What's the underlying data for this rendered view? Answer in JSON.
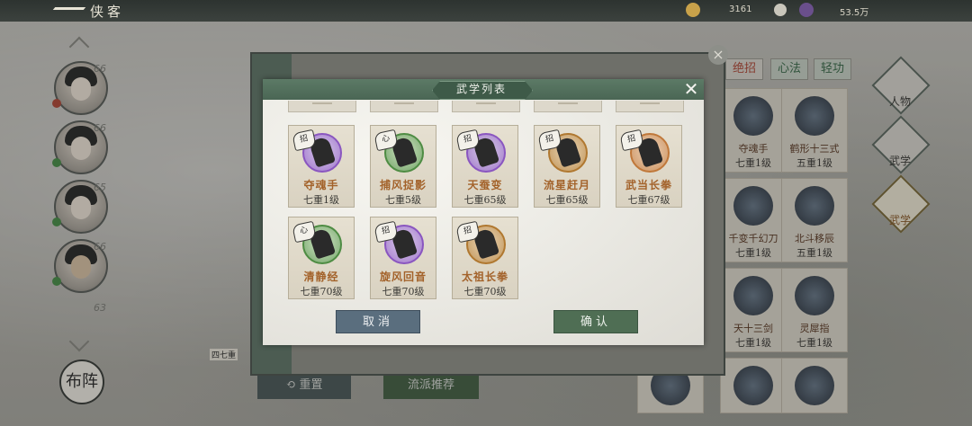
{
  "header": {
    "title": "侠客",
    "resources": [
      {
        "icon": "gold-ingot-icon",
        "value": "3161"
      },
      {
        "icon": "add-icon",
        "value": ""
      },
      {
        "icon": "coin-icon",
        "value": "53.5万"
      }
    ]
  },
  "roster": {
    "levels": [
      "66",
      "66",
      "65",
      "66",
      "63"
    ],
    "formation_label": "布阵"
  },
  "background_buttons": {
    "reset_label": "重置",
    "recommend_label": "流派推荐",
    "partial_level": "四七重"
  },
  "right_panel": {
    "tabs": [
      "绝招",
      "心法",
      "轻功"
    ],
    "cards": [
      {
        "name": "夺魂手",
        "level": "七重1级"
      },
      {
        "name": "鹤形十三式",
        "level": "五重1级"
      },
      {
        "name": "千变千幻刀",
        "level": "七重1级"
      },
      {
        "name": "北斗移辰",
        "level": "五重1级"
      },
      {
        "name": "天十三剑",
        "level": "七重1级"
      },
      {
        "name": "灵犀指",
        "level": "七重1级"
      }
    ],
    "nav": [
      "人物",
      "武学",
      "武学"
    ]
  },
  "modal": {
    "title": "武学列表",
    "close_symbol": "✕",
    "skills": [
      {
        "name": "夺魂手",
        "level": "七重1级",
        "badge": "招",
        "ring": "#8a56c0",
        "bg": "#d7c8ea"
      },
      {
        "name": "捕风捉影",
        "level": "七重5级",
        "badge": "心",
        "ring": "#4e8c43",
        "bg": "#cfe2c3"
      },
      {
        "name": "天蚕变",
        "level": "七重65级",
        "badge": "招",
        "ring": "#8a56c0",
        "bg": "#d8cce6"
      },
      {
        "name": "流星赶月",
        "level": "七重65级",
        "badge": "招",
        "ring": "#b07830",
        "bg": "#ead7b8"
      },
      {
        "name": "武当长拳",
        "level": "七重67级",
        "badge": "招",
        "ring": "#c0783a",
        "bg": "#ecd2b8"
      },
      {
        "name": "清静经",
        "level": "七重70级",
        "badge": "心",
        "ring": "#4e8c43",
        "bg": "#d3e6c8"
      },
      {
        "name": "旋风回音",
        "level": "七重70级",
        "badge": "招",
        "ring": "#8a56c0",
        "bg": "#dccdea"
      },
      {
        "name": "太祖长拳",
        "level": "七重70级",
        "badge": "招",
        "ring": "#b07830",
        "bg": "#ead7b8"
      }
    ],
    "cancel_label": "取消",
    "confirm_label": "确认"
  }
}
